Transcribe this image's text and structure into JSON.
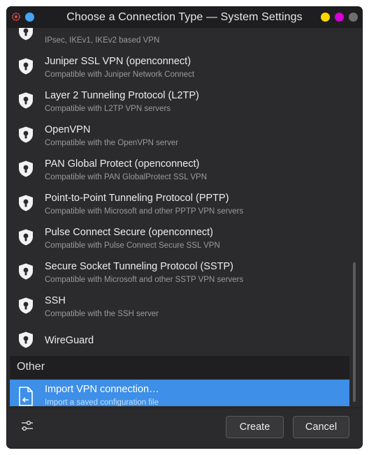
{
  "window": {
    "title": "Choose a Connection Type — System Settings"
  },
  "vpn_items": [
    {
      "name": "",
      "desc": "IPsec, IKEv1, IKEv2 based VPN",
      "icon": "shield-lock-icon"
    },
    {
      "name": "Juniper SSL VPN (openconnect)",
      "desc": "Compatible with Juniper Network Connect",
      "icon": "shield-lock-icon"
    },
    {
      "name": "Layer 2 Tunneling Protocol (L2TP)",
      "desc": "Compatible with L2TP VPN servers",
      "icon": "shield-lock-icon"
    },
    {
      "name": "OpenVPN",
      "desc": "Compatible with the OpenVPN server",
      "icon": "shield-lock-icon"
    },
    {
      "name": "PAN Global Protect (openconnect)",
      "desc": "Compatible with PAN GlobalProtect SSL VPN",
      "icon": "shield-lock-icon"
    },
    {
      "name": "Point-to-Point Tunneling Protocol (PPTP)",
      "desc": "Compatible with Microsoft and other PPTP VPN servers",
      "icon": "shield-lock-icon"
    },
    {
      "name": "Pulse Connect Secure (openconnect)",
      "desc": "Compatible with Pulse Connect Secure SSL VPN",
      "icon": "shield-lock-icon"
    },
    {
      "name": "Secure Socket Tunneling Protocol (SSTP)",
      "desc": "Compatible with Microsoft and other SSTP VPN servers",
      "icon": "shield-lock-icon"
    },
    {
      "name": "SSH",
      "desc": "Compatible with the SSH server",
      "icon": "shield-lock-icon"
    },
    {
      "name": "WireGuard",
      "desc": "",
      "icon": "shield-lock-icon"
    }
  ],
  "section_other": {
    "label": "Other"
  },
  "import_item": {
    "name": "Import VPN connection…",
    "desc": "Import a saved configuration file",
    "icon": "document-import-icon",
    "selected": true
  },
  "footer": {
    "create_label": "Create",
    "cancel_label": "Cancel",
    "settings_icon": "sliders-icon"
  },
  "colors": {
    "window_bg": "#2b2b2d",
    "titlebar_bg": "#1e1e20",
    "selection": "#3d8fe8",
    "close_dot": "#ffd400",
    "minimize_dot": "#d400d4",
    "maximize_dot": "#6e6e70"
  }
}
